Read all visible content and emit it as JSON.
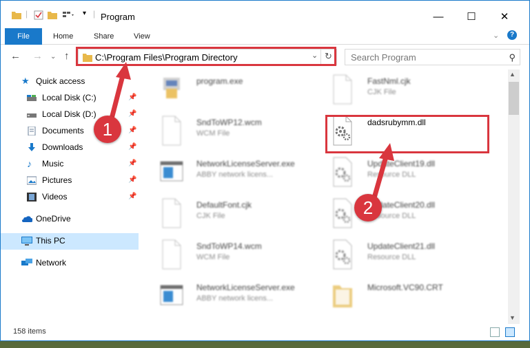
{
  "window": {
    "title": "Program",
    "controls": {
      "minimize": "—",
      "maximize": "☐",
      "close": "✕"
    }
  },
  "ribbon": {
    "tabs": [
      "File",
      "Home",
      "Share",
      "View"
    ]
  },
  "address": {
    "path": "C:\\Program Files\\Program Directory",
    "search_placeholder": "Search Program"
  },
  "sidebar": {
    "items": [
      {
        "label": "Quick access",
        "icon": "star-icon",
        "pinned": false
      },
      {
        "label": "Local Disk (C:)",
        "icon": "drive-icon",
        "pinned": true
      },
      {
        "label": "Local Disk (D:)",
        "icon": "drive-icon",
        "pinned": true
      },
      {
        "label": "Documents",
        "icon": "documents-icon",
        "pinned": true
      },
      {
        "label": "Downloads",
        "icon": "downloads-icon",
        "pinned": true
      },
      {
        "label": "Music",
        "icon": "music-icon",
        "pinned": true
      },
      {
        "label": "Pictures",
        "icon": "pictures-icon",
        "pinned": true
      },
      {
        "label": "Videos",
        "icon": "videos-icon",
        "pinned": true
      },
      {
        "label": "OneDrive",
        "icon": "onedrive-icon",
        "pinned": false
      },
      {
        "label": "This PC",
        "icon": "computer-icon",
        "pinned": false,
        "selected": true
      },
      {
        "label": "Network",
        "icon": "network-icon",
        "pinned": false
      }
    ]
  },
  "files": {
    "left": [
      {
        "name": "program.exe",
        "type": ""
      },
      {
        "name": "SndToWP12.wcm",
        "type": "WCM File"
      },
      {
        "name": "NetworkLicenseServer.exe",
        "type": "ABBY network licens..."
      },
      {
        "name": "DefaultFont.cjk",
        "type": "CJK File"
      },
      {
        "name": "SndToWP14.wcm",
        "type": "WCM File"
      },
      {
        "name": "NetworkLicenseServer.exe",
        "type": "ABBY network licens..."
      }
    ],
    "right": [
      {
        "name": "FastNml.cjk",
        "type": "CJK File"
      },
      {
        "name": "dadsrubymm.dll",
        "type": ""
      },
      {
        "name": "UpdateClient19.dll",
        "type": "Resource DLL"
      },
      {
        "name": "UpdateClient20.dll",
        "type": "Resource DLL"
      },
      {
        "name": "UpdateClient21.dll",
        "type": "Resource DLL"
      },
      {
        "name": "Microsoft.VC90.CRT",
        "type": ""
      }
    ]
  },
  "status": {
    "item_count": "158 items"
  },
  "callouts": {
    "one": "1",
    "two": "2"
  },
  "colors": {
    "accent": "#1979ca",
    "highlight": "#d9363e",
    "selection": "#cce8ff"
  }
}
